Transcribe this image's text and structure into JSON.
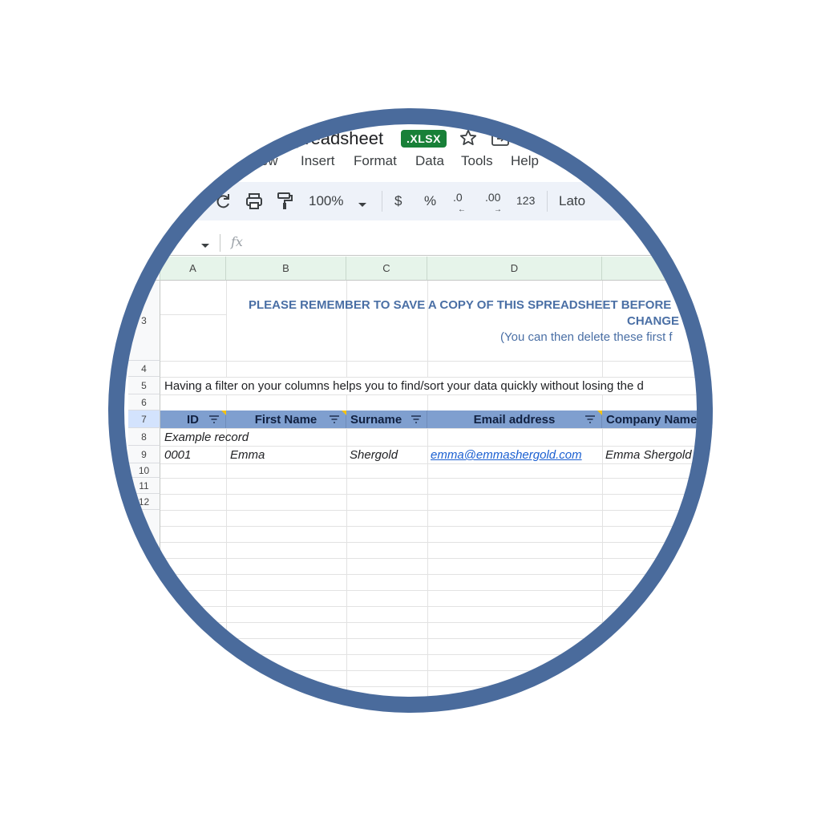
{
  "titlebar": {
    "doc_title": "preadsheet",
    "badge": ".XLSX",
    "star_icon": "star-icon",
    "move_icon": "move-to-folder-icon"
  },
  "menu": [
    "iew",
    "Insert",
    "Format",
    "Data",
    "Tools",
    "Help"
  ],
  "toolbar": {
    "zoom": "100%",
    "currency": "$",
    "percent": "%",
    "dec_decrease": ".0",
    "dec_increase": ".00",
    "number_format": "123",
    "font": "Lato"
  },
  "formula_bar": {
    "fx": "fx"
  },
  "columns": [
    "A",
    "B",
    "C",
    "D"
  ],
  "rows": [
    "3",
    "4",
    "5",
    "6",
    "7",
    "8",
    "9",
    "10",
    "11",
    "12"
  ],
  "sheet": {
    "notice_line1": "PLEASE REMEMBER TO SAVE A COPY OF THIS SPREADSHEET BEFORE",
    "notice_line2": "CHANGE",
    "notice_line3": "(You can then delete these first f",
    "filter_note": "Having a filter on your columns helps you to find/sort your data quickly without losing the d",
    "headers": [
      "ID",
      "First Name",
      "Surname",
      "Email address",
      "Company Name"
    ],
    "example_label": "Example record",
    "record": {
      "id": "0001",
      "first_name": "Emma",
      "surname": "Shergold",
      "email": "emma@emmashergold.com",
      "company": "Emma Shergold"
    }
  },
  "colors": {
    "ring": "#4a6b9c",
    "header_fill": "#7f9fcf",
    "notice_text": "#4a6fa5",
    "badge": "#188038"
  }
}
